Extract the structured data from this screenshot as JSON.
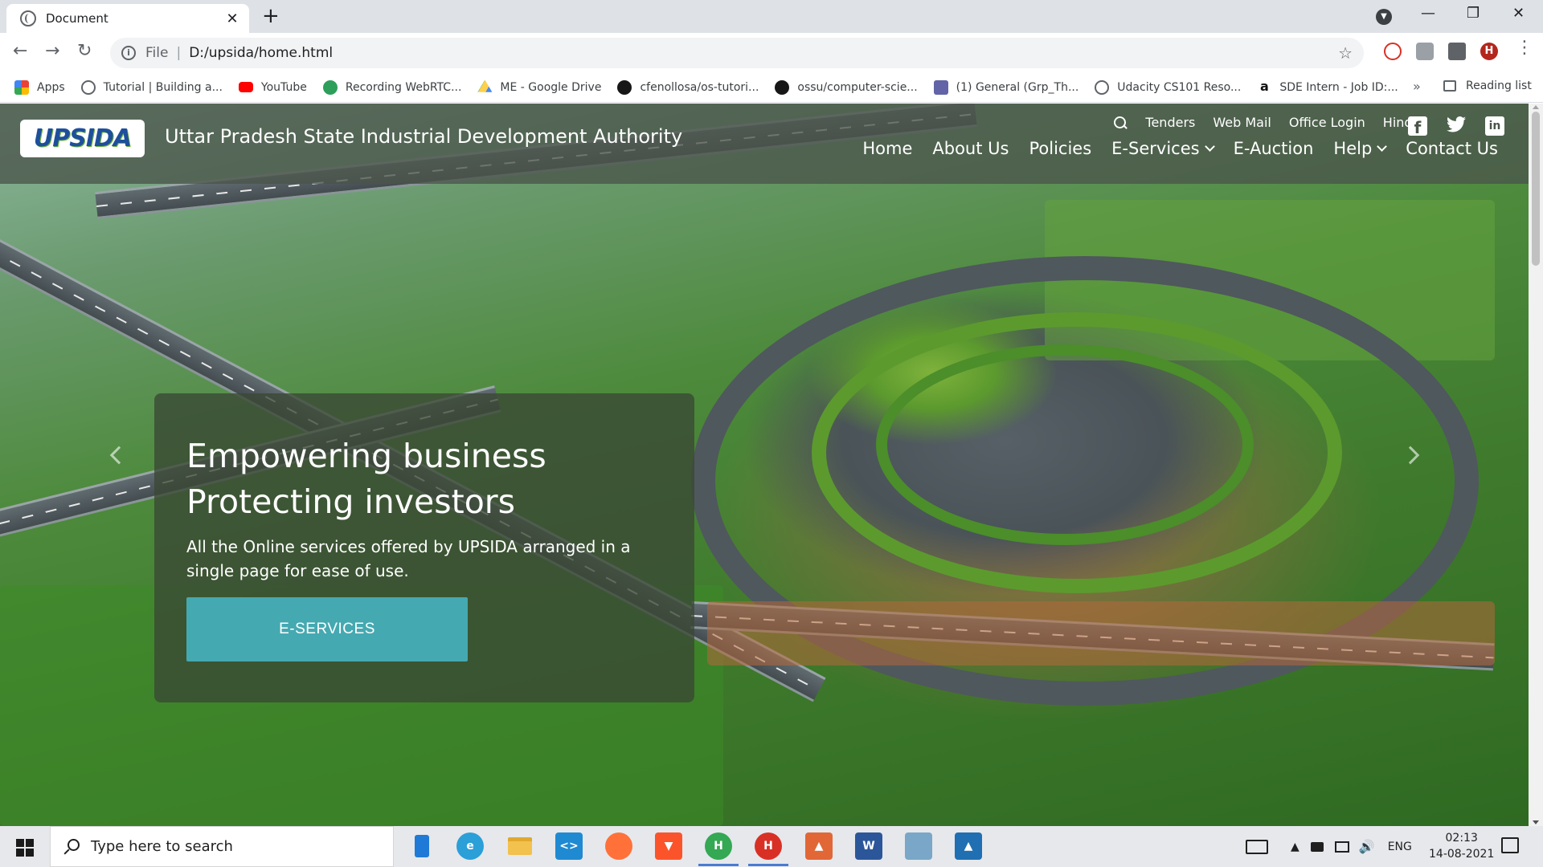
{
  "browser": {
    "tab_title": "Document",
    "url_scheme": "File",
    "url": "D:/upsida/home.html",
    "bookmarks": [
      {
        "label": "Apps",
        "icon": "apps-grid-icon",
        "color": "#ea4335"
      },
      {
        "label": "Tutorial | Building a...",
        "icon": "globe-icon",
        "color": "#5f6368"
      },
      {
        "label": "YouTube",
        "icon": "youtube-icon",
        "color": "#ff0000"
      },
      {
        "label": "Recording WebRTC...",
        "icon": "webrtc-icon",
        "color": "#2e9e5b"
      },
      {
        "label": "ME - Google Drive",
        "icon": "google-drive-icon",
        "color": "#1fa463"
      },
      {
        "label": "cfenollosa/os-tutori...",
        "icon": "github-icon",
        "color": "#181717"
      },
      {
        "label": "ossu/computer-scie...",
        "icon": "github-icon",
        "color": "#181717"
      },
      {
        "label": "(1) General (Grp_Th...",
        "icon": "teams-icon",
        "color": "#6264a7"
      },
      {
        "label": "Udacity CS101 Reso...",
        "icon": "globe-icon",
        "color": "#5f6368"
      },
      {
        "label": "SDE Intern - Job ID:...",
        "icon": "amazon-icon",
        "color": "#111111"
      }
    ],
    "more_bookmarks": "»",
    "reading_list": "Reading list"
  },
  "site": {
    "logo_text": "UPSIDA",
    "title": "Uttar Pradesh State Industrial Development Authority",
    "util_links": [
      "Tenders",
      "Web Mail",
      "Office Login",
      "Hindi"
    ],
    "nav": [
      {
        "label": "Home",
        "dropdown": false
      },
      {
        "label": "About Us",
        "dropdown": false
      },
      {
        "label": "Policies",
        "dropdown": false
      },
      {
        "label": "E-Services",
        "dropdown": true
      },
      {
        "label": "E-Auction",
        "dropdown": false
      },
      {
        "label": "Help",
        "dropdown": true
      },
      {
        "label": "Contact Us",
        "dropdown": false
      }
    ],
    "social": {
      "facebook": "f",
      "twitter": "🐦",
      "linkedin": "in"
    }
  },
  "hero": {
    "line1": "Empowering business",
    "line2": "Protecting investors",
    "text": "All the Online services offered by UPSIDA arranged in a single page for ease of use.",
    "cta": "E-SERVICES"
  },
  "taskbar": {
    "search_placeholder": "Type here to search",
    "apps": [
      {
        "name": "file-icon",
        "color": "#1e7ad6",
        "label": ""
      },
      {
        "name": "edge-icon",
        "color": "#2a9fd8",
        "label": "e"
      },
      {
        "name": "file-explorer-icon",
        "color": "#f2c14e",
        "label": ""
      },
      {
        "name": "vscode-icon",
        "color": "#1f8ad2",
        "label": "<>"
      },
      {
        "name": "firefox-icon",
        "color": "#ff7139",
        "label": ""
      },
      {
        "name": "brave-icon",
        "color": "#fb542b",
        "label": "▼"
      },
      {
        "name": "chrome-h-icon",
        "color": "#34a853",
        "label": "H"
      },
      {
        "name": "chrome-h-active-icon",
        "color": "#d93025",
        "label": "H"
      },
      {
        "name": "matlab-icon",
        "color": "#e16737",
        "label": "▲"
      },
      {
        "name": "word-icon",
        "color": "#2b579a",
        "label": "W"
      },
      {
        "name": "notepad-icon",
        "color": "#7aa7c7",
        "label": ""
      },
      {
        "name": "photos-icon",
        "color": "#1f6fb2",
        "label": "▲"
      }
    ],
    "lang": "ENG",
    "time": "02:13",
    "date": "14-08-2021"
  }
}
